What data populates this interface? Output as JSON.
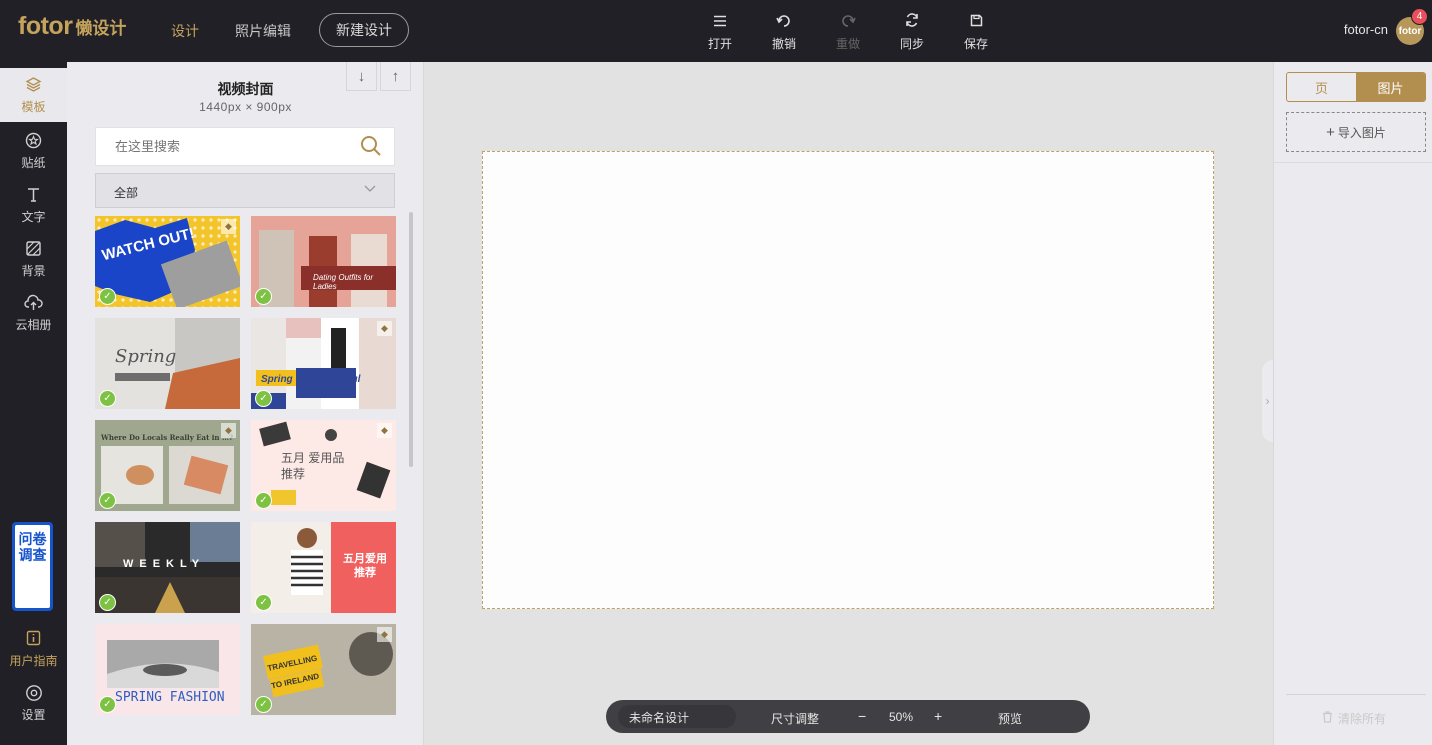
{
  "header": {
    "brand": "fotor",
    "brand_sub": "懒设计",
    "nav_design": "设计",
    "nav_photo_edit": "照片编辑",
    "new_design": "新建设计",
    "tools": {
      "open": "打开",
      "undo": "撤销",
      "redo": "重做",
      "sync": "同步",
      "save": "保存"
    },
    "user": "fotor-cn",
    "avatar_text": "fotor",
    "notification_count": "4"
  },
  "leftnav": {
    "templates": "模板",
    "stickers": "贴纸",
    "text": "文字",
    "background": "背景",
    "cloud": "云相册",
    "survey": "问卷调查",
    "guide": "用户指南",
    "settings": "设置"
  },
  "panel": {
    "title": "视频封面",
    "size": "1440px × 900px",
    "search_placeholder": "在这里搜索",
    "filter": "全部",
    "thumbs": [
      {
        "text": "WATCH OUT!",
        "vip": true
      },
      {
        "text": "Dating Outfits for Ladies",
        "vip": false
      },
      {
        "text": "Spring",
        "vip": false
      },
      {
        "text": "Spring Clothing Haul",
        "vip": true
      },
      {
        "text": "Where Do Locals Really Eat in …?",
        "vip": true
      },
      {
        "text": "五月 爱用品推荐",
        "vip": true
      },
      {
        "text": "WEEKLY",
        "vip": false
      },
      {
        "text": "五月爱用 推荐",
        "vip": false
      },
      {
        "text": "SPRING FASHION",
        "vip": false
      },
      {
        "text": "TRAVELLING TO IRELAND",
        "vip": true
      }
    ]
  },
  "bottombar": {
    "name": "未命名设计",
    "resize": "尺寸调整",
    "zoom_out": "−",
    "zoom": "50%",
    "zoom_in": "+",
    "preview": "预览"
  },
  "rightpanel": {
    "tab_page": "页",
    "tab_images": "图片",
    "import": "导入图片",
    "clear_all": "清除所有"
  }
}
